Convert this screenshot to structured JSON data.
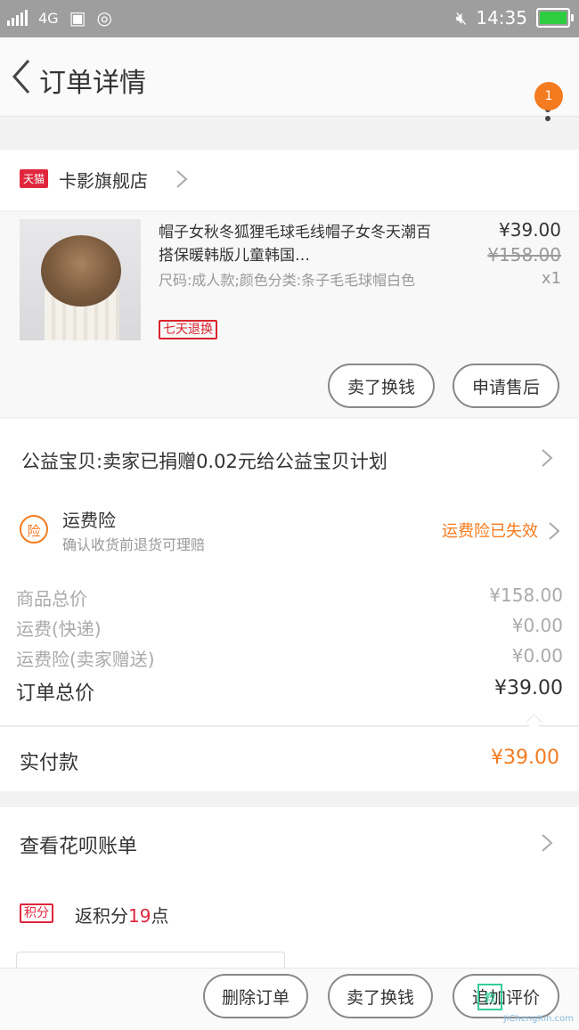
{
  "status_bar": {
    "network": "4G",
    "time": "14:35",
    "battery_level": 0.9
  },
  "nav": {
    "title": "订单详情",
    "badge": "1"
  },
  "shop": {
    "tmall_label": "天猫",
    "name": "卡影旗舰店"
  },
  "item": {
    "title": "帽子女秋冬狐狸毛球毛线帽子女冬天潮百搭保暖韩版儿童韩国…",
    "sku": "尺码:成人款;颜色分类:条子毛毛球帽白色",
    "tag": "七天退换",
    "price": "¥39.00",
    "original_price": "¥158.00",
    "qty": "x1",
    "buttons": {
      "refund": "卖了换钱",
      "after_sale": "申请售后"
    }
  },
  "charity": {
    "text": "公益宝贝:卖家已捐赠0.02元给公益宝贝计划"
  },
  "insurance": {
    "icon_label": "险",
    "title": "运费险",
    "subtitle": "确认收货前退货可理赔",
    "status": "运费险已失效"
  },
  "summary": {
    "rows": [
      {
        "label": "商品总价",
        "value": "¥158.00"
      },
      {
        "label": "运费(快递)",
        "value": "¥0.00"
      },
      {
        "label": "运费险(卖家赠送)",
        "value": "¥0.00"
      }
    ],
    "total_label": "订单总价",
    "total_value": "¥39.00"
  },
  "paid": {
    "label": "实付款",
    "value": "¥39.00"
  },
  "huabei": {
    "label": "查看花呗账单"
  },
  "points": {
    "tag": "积分",
    "prefix": "返积分",
    "value": "19",
    "suffix": "点"
  },
  "bottom_bar": {
    "delete": "删除订单",
    "sell": "卖了换钱",
    "review": "追加评价"
  },
  "watermark": {
    "text": "JiChengXin.com"
  },
  "colors": {
    "accent": "#f47b20",
    "tmall_red": "#e0263d",
    "status_bar": "#9e9e9e"
  }
}
